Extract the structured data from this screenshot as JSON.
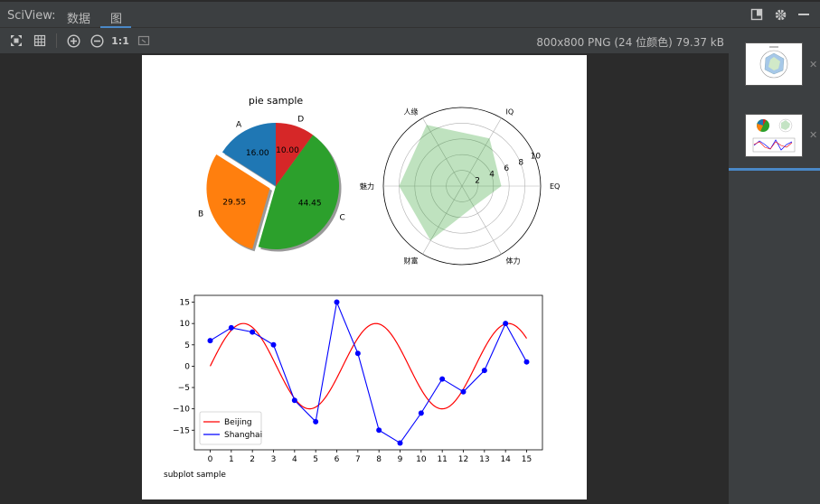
{
  "window": {
    "title": "SciView:",
    "tabs": [
      {
        "label": "数据",
        "active": false
      },
      {
        "label": "图",
        "active": true
      }
    ]
  },
  "toolbar": {
    "icons": [
      "fit-screen-icon",
      "grid-icon",
      "zoom-in-icon",
      "zoom-out-icon",
      "actual-size-icon",
      "fit-window-icon"
    ],
    "actual_size_label": "1:1",
    "image_info": "800x800 PNG (24 位颜色) 79.37 kB"
  },
  "colors": {
    "background": "#2b2b2b",
    "panel": "#3c3f41",
    "accent": "#4a88c7"
  },
  "sidebar": {
    "thumbnails": [
      {
        "name": "radar-thumbnail",
        "selected": false
      },
      {
        "name": "subplots-thumbnail",
        "selected": true
      }
    ]
  },
  "chart_data": [
    {
      "type": "pie",
      "title": "pie sample",
      "labels": [
        "A",
        "B",
        "C",
        "D"
      ],
      "values": [
        16.0,
        29.55,
        44.45,
        10.0
      ],
      "value_labels": [
        "16.00",
        "29.55",
        "44.45",
        "10.00"
      ],
      "colors": [
        "#1f77b4",
        "#ff7f0e",
        "#2ca02c",
        "#d62728"
      ],
      "explode": [
        0,
        0.1,
        0,
        0
      ],
      "shadow": true,
      "startangle": 90
    },
    {
      "type": "radar",
      "labels": [
        "EQ",
        "IQ",
        "人缘",
        "魅力",
        "财富",
        "体力"
      ],
      "values": [
        5,
        7,
        9,
        8,
        8,
        3
      ],
      "rticks": [
        2,
        4,
        6,
        8,
        10
      ],
      "rmax": 10,
      "fill_color": "#2ca02c",
      "fill_alpha": 0.3,
      "grid": true
    },
    {
      "type": "line",
      "xlabel": "subplot sample",
      "x_ticks": [
        0,
        1,
        2,
        3,
        4,
        5,
        6,
        7,
        8,
        9,
        10,
        11,
        12,
        13,
        14,
        15
      ],
      "y_ticks": [
        -15,
        -10,
        -5,
        0,
        5,
        10,
        15
      ],
      "xlim": [
        -0.75,
        15.75
      ],
      "ylim": [
        -19.6,
        16.6
      ],
      "legend_position": "lower-left",
      "series": [
        {
          "name": "Beijing",
          "color": "#ff0000",
          "function": "10*sin(x)",
          "marker": "none"
        },
        {
          "name": "Shanghai",
          "color": "#0000ff",
          "marker": "circle",
          "x": [
            0,
            1,
            2,
            3,
            4,
            5,
            6,
            7,
            8,
            9,
            10,
            11,
            12,
            13,
            14,
            15
          ],
          "values": [
            6,
            9,
            8,
            5,
            -8,
            -13,
            15,
            3,
            -15,
            -18,
            -11,
            -3,
            -6,
            -1,
            10,
            1
          ]
        }
      ]
    }
  ]
}
